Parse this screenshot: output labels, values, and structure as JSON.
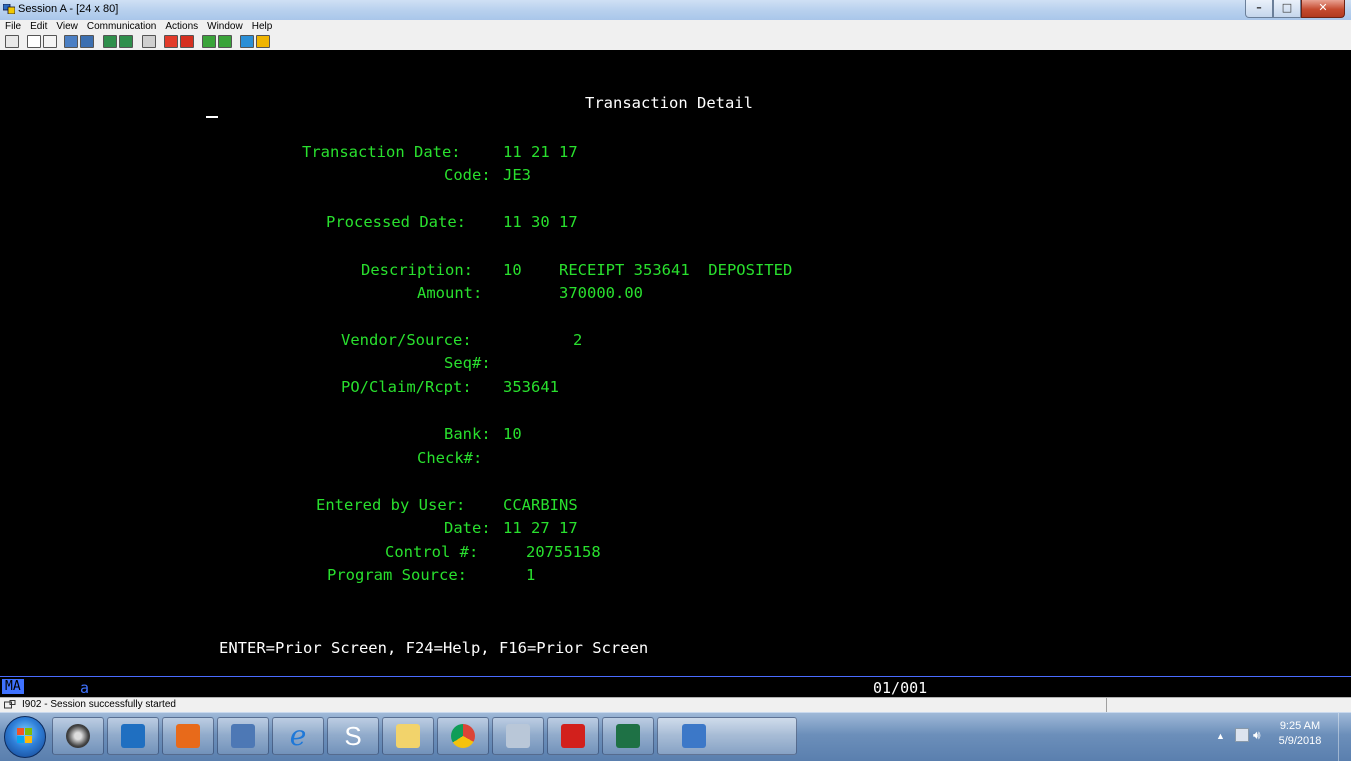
{
  "window": {
    "title": "Session A - [24 x 80]",
    "controls": [
      "minimize",
      "maximize",
      "close"
    ]
  },
  "menu": {
    "items": [
      "File",
      "Edit",
      "View",
      "Communication",
      "Actions",
      "Window",
      "Help"
    ]
  },
  "toolbar": {
    "icons": [
      "print-screen-icon",
      "copy-icon",
      "paste-icon",
      "send-icon",
      "receive-icon",
      "display-icon",
      "display-2-icon",
      "keyboard-icon",
      "macro-record-icon",
      "macro-stop-icon",
      "macro-play-icon",
      "macro-edit-icon",
      "support-icon",
      "help-icon"
    ]
  },
  "terminal": {
    "title": "Transaction Detail",
    "transaction_date_label": "Transaction Date:",
    "transaction_date": "11 21 17",
    "code_label": "Code:",
    "code": "JE3",
    "processed_date_label": "Processed Date:",
    "processed_date": "11 30 17",
    "description_label": "Description:",
    "description_code": "10",
    "description_text": "RECEIPT 353641  DEPOSITED",
    "amount_label": "Amount:",
    "amount": "370000.00",
    "vendor_label": "Vendor/Source:",
    "vendor": "2",
    "seq_label": "Seq#:",
    "po_label": "PO/Claim/Rcpt:",
    "po": "353641",
    "bank_label": "Bank:",
    "bank": "10",
    "check_label": "Check#:",
    "entered_by_label": "Entered by User:",
    "entered_by": "CCARBINS",
    "date_label": "Date:",
    "date": "11 27 17",
    "control_label": "Control #:",
    "control": "20755158",
    "program_source_label": "Program Source:",
    "program_source": "1",
    "function_keys": "ENTER=Prior Screen, F24=Help, F16=Prior Screen"
  },
  "oia": {
    "mode": "MA",
    "indicator": "a",
    "cursor_position": "01/001"
  },
  "status": {
    "message": "I902 - Session successfully started"
  },
  "taskbar": {
    "apps": [
      "camera-app",
      "outlook",
      "office-app",
      "network-app",
      "internet-explorer",
      "sigma-app",
      "file-explorer",
      "chrome",
      "calculator",
      "acrobat",
      "excel",
      "pcomm-session"
    ],
    "time": "9:25 AM",
    "date": "5/9/2018"
  },
  "colors": {
    "terminal_bg": "#000000",
    "terminal_text": "#29e02e",
    "oia_accent": "#3f72ff"
  }
}
